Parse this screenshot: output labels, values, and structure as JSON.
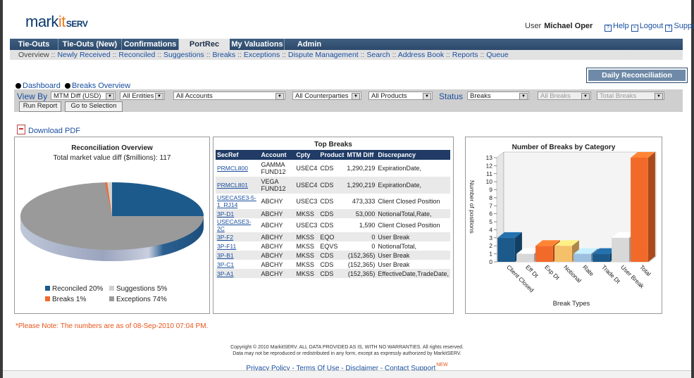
{
  "logo": {
    "mark": "mark",
    "it": "it",
    "serv": "SERV"
  },
  "user": {
    "label": "User",
    "name": "Michael Oper"
  },
  "toplinks": [
    "Help",
    "Logout",
    "Support"
  ],
  "tabs": [
    "Tie-Outs",
    "Tie-Outs (New)",
    "Confirmations",
    "PortRec",
    "My Valuations",
    "Admin"
  ],
  "active_tab": "PortRec",
  "subnav": [
    "Overview",
    "Newly Received",
    "Reconciled",
    "Suggestions",
    "Breaks",
    "Exceptions",
    "Dispute Management",
    "Search",
    "Address Book",
    "Reports",
    "Queue"
  ],
  "dashboard_links": [
    "Dashboard",
    "Breaks Overview"
  ],
  "switch_label": "Daily Reconciliation [Switch]",
  "filters": {
    "view_by_label": "View By",
    "view_by": "MTM Diff (USD)",
    "entities": "All Entities",
    "accounts": "All Accounts",
    "counterparties": "All Counterparties",
    "products": "All Products",
    "status_label": "Status",
    "status": "Breaks",
    "breaks": "All Breaks",
    "total": "Total Breaks",
    "run_report": "Run Report",
    "go_to_selection": "Go to Selection"
  },
  "download_pdf": "Download PDF",
  "recon": {
    "title": "Reconciliation Overview",
    "subtitle": "Total market value diff ($millions): 117",
    "legend": [
      {
        "label": "Reconciled 20%",
        "color": "#1c5a8c"
      },
      {
        "label": "Suggestions 5%",
        "color": "#cfcfcf"
      },
      {
        "label": "Breaks 1%",
        "color": "#f26a2a"
      },
      {
        "label": "Exceptions 74%",
        "color": "#9a9a9a"
      }
    ]
  },
  "top_breaks": {
    "title": "Top Breaks",
    "headers": [
      "SecRef",
      "Account",
      "Cpty",
      "Product",
      "MTM Diff",
      "Discrepancy"
    ],
    "rows": [
      [
        "PRMCL800",
        "GAMMA FUND12",
        "USEC4",
        "CDS",
        "1,290,219",
        "ExpirationDate,"
      ],
      [
        "PRMCL801",
        "VEGA FUND12",
        "USEC4",
        "CDS",
        "1,290,219",
        "ExpirationDate,"
      ],
      [
        "USECASE3-5-1_RJ14",
        "ABCHY",
        "USEC3",
        "CDS",
        "473,333",
        "Client Closed Position"
      ],
      [
        "3P-D1",
        "ABCHY",
        "MKSS",
        "CDS",
        "53,000",
        "NotionalTotal,Rate,"
      ],
      [
        "USECASE3-2C",
        "ABCHY",
        "USEC3",
        "CDS",
        "1,590",
        "Client Closed Position"
      ],
      [
        "3P-F2",
        "ABCHY",
        "MKSS",
        "EQO",
        "0",
        "User Break"
      ],
      [
        "3P-F11",
        "ABCHY",
        "MKSS",
        "EQVS",
        "0",
        "NotionalTotal,"
      ],
      [
        "3P-B1",
        "ABCHY",
        "MKSS",
        "CDS",
        "(152,365)",
        "User Break"
      ],
      [
        "3P-C1",
        "ABCHY",
        "MKSS",
        "CDS",
        "(152,365)",
        "User Break"
      ],
      [
        "3P-A1",
        "ABCHY",
        "MKSS",
        "CDS",
        "(152,365)",
        "EffectiveDate,TradeDate,"
      ]
    ]
  },
  "chart_data": {
    "type": "bar",
    "title": "Number of Breaks by Category",
    "xlabel": "Break Types",
    "ylabel": "Number of positions",
    "categories": [
      "Client Closed",
      "Eff Dt",
      "Exp Dt",
      "Notional",
      "Rate",
      "Trade Dt",
      "User Break",
      "Total"
    ],
    "values": [
      3,
      1,
      2,
      2,
      1,
      1,
      3,
      13
    ],
    "colors": [
      "#1c5a8c",
      "#d8d8d8",
      "#f26a2a",
      "#f5c06a",
      "#9ec0e0",
      "#1c5a8c",
      "#d8d8d8",
      "#f26a2a"
    ],
    "yticks": [
      0,
      1,
      2,
      3,
      4,
      5,
      6,
      7,
      8,
      9,
      10,
      11,
      12,
      13
    ],
    "ylim": [
      0,
      13
    ]
  },
  "note": "*Please Note: The numbers are as of 08-Sep-2010 07:04 PM.",
  "copyright": [
    "Copyright © 2010 MarkitSERV. ALL DATA PROVIDED AS IS, WITH NO WARRANTIES. All rights reserved.",
    "Data may not be reproduced or redistributed in any form, except as expressly authorized by MarkitSERV."
  ],
  "footer_links": [
    "Privacy Policy",
    "Terms Of Use",
    "Disclaimer",
    "Contact Support"
  ],
  "footer_new": "NEW"
}
